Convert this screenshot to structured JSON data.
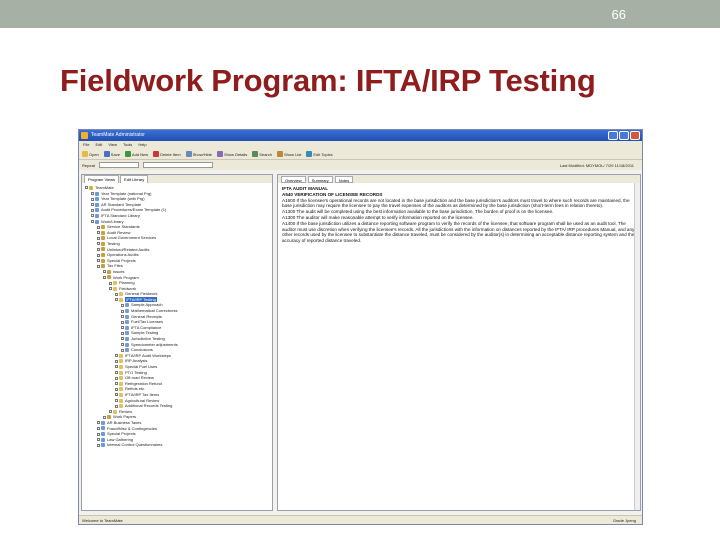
{
  "slide": {
    "number": "66",
    "title": "Fieldwork Program: IFTA/IRP Testing",
    "topbar_color": "#a7b0a4",
    "title_color": "#8f1d1d"
  },
  "window": {
    "title": "TeamMate Administrator",
    "menu": [
      "File",
      "Edit",
      "View",
      "Tools",
      "Help"
    ],
    "toolbar": [
      {
        "label": "Open",
        "icon": "folder-icon",
        "color": "#e8b84a"
      },
      {
        "label": "Save",
        "icon": "save-icon",
        "color": "#4a6fc8"
      },
      {
        "label": "Add New",
        "icon": "add-icon",
        "color": "#3a9a3a"
      },
      {
        "label": "Delete Item",
        "icon": "delete-icon",
        "color": "#c83a3a"
      },
      {
        "label": "Show/Hide",
        "icon": "eye-icon",
        "color": "#6a8ab8"
      },
      {
        "label": "Show Details",
        "icon": "details-icon",
        "color": "#8a6ab8"
      },
      {
        "label": "Search",
        "icon": "search-icon",
        "color": "#5a8a5a"
      },
      {
        "label": "Show List",
        "icon": "list-icon",
        "color": "#b88a3a"
      },
      {
        "label": "Edit Topics",
        "icon": "edit-icon",
        "color": "#3a8ab8"
      }
    ],
    "subbar": {
      "label": "Repeat"
    },
    "last_modified": "Last Modified:  MDYMOL/ 7/29  11/18/2011"
  },
  "left_pane": {
    "tabs": [
      "Program Views",
      "Edit Library"
    ],
    "tree": [
      {
        "label": "TeamMate",
        "indent": 0,
        "color": "#d8b040"
      },
      {
        "label": "Year Template (national Prg)",
        "indent": 1,
        "color": "#6a9ad8"
      },
      {
        "label": "Year Template (with Prg)",
        "indent": 1,
        "color": "#6a9ad8"
      },
      {
        "label": "AR Standard Template",
        "indent": 1,
        "color": "#6a9ad8"
      },
      {
        "label": "Audit Procedures/Exam Template (1)",
        "indent": 1,
        "color": "#6a9ad8"
      },
      {
        "label": "IFTA Standard Library",
        "indent": 1,
        "color": "#6a9ad8"
      },
      {
        "label": "Work/Library",
        "indent": 1,
        "color": "#6a9ad8"
      },
      {
        "label": "Service Standards",
        "indent": 2,
        "color": "#c8a040"
      },
      {
        "label": "Audit Review",
        "indent": 2,
        "color": "#c8a040"
      },
      {
        "label": "Local Government Services",
        "indent": 2,
        "color": "#c8a040"
      },
      {
        "label": "Testing",
        "indent": 2,
        "color": "#c8a040"
      },
      {
        "label": "Unlinked/Related Audits",
        "indent": 2,
        "color": "#c8a040"
      },
      {
        "label": "Operations Audits",
        "indent": 2,
        "color": "#c8a040"
      },
      {
        "label": "Special Projects",
        "indent": 2,
        "color": "#c8a040"
      },
      {
        "label": "Tax Files",
        "indent": 2,
        "color": "#c8a040"
      },
      {
        "label": "Issues",
        "indent": 3,
        "color": "#c8a040"
      },
      {
        "label": "Work Program",
        "indent": 3,
        "color": "#c8a040"
      },
      {
        "label": "Planning",
        "indent": 4,
        "color": "#e0c060"
      },
      {
        "label": "Fieldwork",
        "indent": 4,
        "color": "#e0c060"
      },
      {
        "label": "General Fieldwork",
        "indent": 5,
        "color": "#e0c060"
      },
      {
        "label": "IFTA/IRP Testing",
        "indent": 5,
        "color": "#e0c060",
        "selected": true
      },
      {
        "label": "Sample Approach",
        "indent": 6,
        "color": "#7a9ad0"
      },
      {
        "label": "Mathematical Correctness",
        "indent": 6,
        "color": "#7a9ad0"
      },
      {
        "label": "General Receipts",
        "indent": 6,
        "color": "#7a9ad0"
      },
      {
        "label": "Fuel/Tax Licenses",
        "indent": 6,
        "color": "#7a9ad0"
      },
      {
        "label": "IFTA Compliance",
        "indent": 6,
        "color": "#7a9ad0"
      },
      {
        "label": "Sample Testing",
        "indent": 6,
        "color": "#7a9ad0"
      },
      {
        "label": "Jurisdiction Testing",
        "indent": 6,
        "color": "#7a9ad0"
      },
      {
        "label": "Speedometer adjustments",
        "indent": 6,
        "color": "#7a9ad0"
      },
      {
        "label": "Conclusions",
        "indent": 6,
        "color": "#7a9ad0"
      },
      {
        "label": "IFTA/IRP Audit Worksteps",
        "indent": 5,
        "color": "#e0c060"
      },
      {
        "label": "IRP Analysis",
        "indent": 5,
        "color": "#e0c060"
      },
      {
        "label": "Special Fuel Uses",
        "indent": 5,
        "color": "#e0c060"
      },
      {
        "label": "PTO Testing",
        "indent": 5,
        "color": "#e0c060"
      },
      {
        "label": "Off-road Review",
        "indent": 5,
        "color": "#e0c060"
      },
      {
        "label": "Refrigeration Refund",
        "indent": 5,
        "color": "#e0c060"
      },
      {
        "label": "Refrids etc.",
        "indent": 5,
        "color": "#e0c060"
      },
      {
        "label": "IFTA/IRP Tax Items",
        "indent": 5,
        "color": "#e0c060"
      },
      {
        "label": "Agricultural Review",
        "indent": 5,
        "color": "#e0c060"
      },
      {
        "label": "Additional Records Testing",
        "indent": 5,
        "color": "#e0c060"
      },
      {
        "label": "Review",
        "indent": 4,
        "color": "#e0c060"
      },
      {
        "label": "Work Papers",
        "indent": 3,
        "color": "#c8a040"
      },
      {
        "label": "AR Business Taxes",
        "indent": 2,
        "color": "#6a9ad8"
      },
      {
        "label": "Fraud/Misc & Contingencies",
        "indent": 2,
        "color": "#6a9ad8"
      },
      {
        "label": "Special Projects",
        "indent": 2,
        "color": "#6a9ad8"
      },
      {
        "label": "Law Gathering",
        "indent": 2,
        "color": "#6a9ad8"
      },
      {
        "label": "Internal Control Questionnaires",
        "indent": 2,
        "color": "#6a9ad8"
      }
    ]
  },
  "right_pane": {
    "tabs": [
      "Overview",
      "Summary",
      "Notes"
    ],
    "heading1": "IFTA AUDIT MANUAL",
    "heading2": "A540 VERIFICATION OF LICENSEE RECORDS",
    "paragraphs": [
      "A1600 If the licensee's operational records are not located in the base jurisdiction and the base jurisdiction's auditors must travel to where such records are maintained, the base jurisdiction may require the licensee to pay the travel expenses of the auditors as determined by the base jurisdiction (short-term fees in relation thereto).",
      "A1300 The audit will be completed using the best information available to the base jurisdiction. The burden of proof is on the licensee.",
      "A1300 The auditor will make reasonable attempt to verify information reported on the licensee.",
      "A1400 If the base jurisdiction utilizes a distance reporting software program to verify the records of the licensee, that software program shall be used as an audit tool. The auditor must use discretion when verifying the licensee's records. All the jurisdictions with the information on distances reported by the IFTA/ IRP procedures Manual, and any other records used by the licensee to substantiate the distance traveled, must be considered by the auditor(s) in determining an acceptable distance reporting system and the accuracy of reported distance traveled."
    ]
  },
  "status": {
    "left": "Welcome to TeamMate",
    "right": "Grade   Jpeng"
  }
}
